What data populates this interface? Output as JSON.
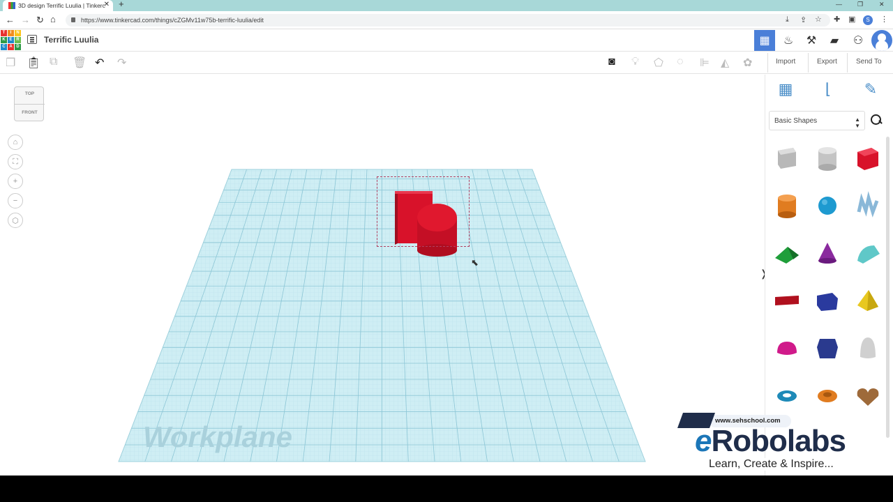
{
  "browser": {
    "tab_title": "3D design Terrific Luulia | Tinkerc",
    "url": "https://www.tinkercad.com/things/cZGMv11w75b-terrific-luulia/edit",
    "profile_initial": "S"
  },
  "header": {
    "logo_letters": [
      "TIN",
      "KER",
      "CAD"
    ],
    "design_title": "Terrific Luulia",
    "icons": [
      "grid-view-icon",
      "lightbulb-robot-icon",
      "pickaxe-icon",
      "bricks-icon",
      "add-user-icon",
      "avatar"
    ]
  },
  "toolbar": {
    "left_icons": [
      "copy-icon",
      "paste-icon",
      "duplicate-icon",
      "delete-icon",
      "undo-icon",
      "redo-icon"
    ],
    "right_icons": [
      "note-icon",
      "light-icon",
      "shape-icon",
      "hole-icon",
      "align-icon",
      "mirror-icon",
      "group-icon"
    ],
    "import_label": "Import",
    "export_label": "Export",
    "sendto_label": "Send To"
  },
  "viewcube": {
    "top_label": "TOP",
    "front_label": "FRONT"
  },
  "view_controls": [
    "home-view",
    "fit-view",
    "zoom-in",
    "zoom-out",
    "perspective"
  ],
  "workplane": {
    "label": "Workplane"
  },
  "panel": {
    "tool_icons": [
      "workplane-icon",
      "ruler-icon",
      "notes-icon"
    ],
    "category": "Basic Shapes",
    "shapes": [
      {
        "name": "box-hole",
        "color": "#b8b8b8"
      },
      {
        "name": "cylinder-hole",
        "color": "#c4c4c4"
      },
      {
        "name": "box",
        "color": "#d8122a"
      },
      {
        "name": "cylinder",
        "color": "#e07c20"
      },
      {
        "name": "sphere",
        "color": "#1e9ad0"
      },
      {
        "name": "scribble",
        "color": "#8ab8d8"
      },
      {
        "name": "roof",
        "color": "#1f9e3a"
      },
      {
        "name": "cone",
        "color": "#8a2a9e"
      },
      {
        "name": "round-roof",
        "color": "#5fc8c8"
      },
      {
        "name": "text",
        "color": "#b0101e"
      },
      {
        "name": "half-sphere-box",
        "color": "#2a3a9e"
      },
      {
        "name": "pyramid",
        "color": "#e8c820"
      },
      {
        "name": "half-sphere",
        "color": "#d01a8a"
      },
      {
        "name": "polygon",
        "color": "#2a3a8e"
      },
      {
        "name": "paraboloid",
        "color": "#d0d0d0"
      },
      {
        "name": "torus",
        "color": "#1e8ab8"
      },
      {
        "name": "tube",
        "color": "#e07c20"
      },
      {
        "name": "heart",
        "color": "#9e6a3a"
      }
    ]
  },
  "watermark": {
    "url": "www.sehschool.com",
    "brand_e": "e",
    "brand_rest": "Robolabs",
    "tagline": "Learn, Create & Inspire..."
  }
}
